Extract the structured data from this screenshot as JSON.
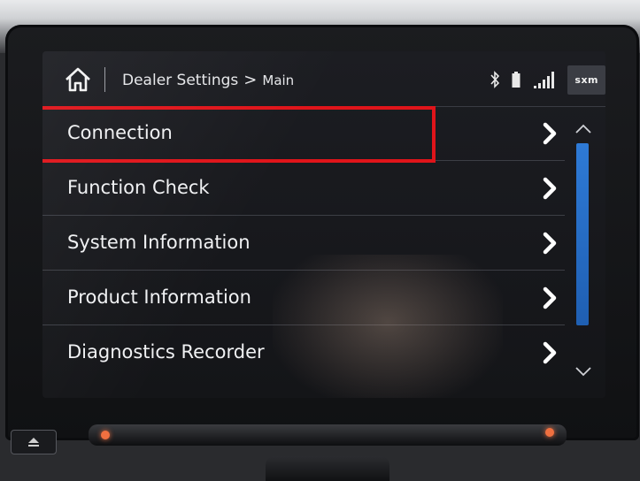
{
  "header": {
    "breadcrumb_root": "Dealer Settings",
    "breadcrumb_separator": ">",
    "breadcrumb_leaf": "Main",
    "status_icons": [
      "bluetooth-icon",
      "battery-icon",
      "signal-icon"
    ],
    "sxm_label": "sxm"
  },
  "menu": {
    "items": [
      {
        "label": "Connection",
        "highlighted": true
      },
      {
        "label": "Function Check"
      },
      {
        "label": "System Information"
      },
      {
        "label": "Product Information"
      },
      {
        "label": "Diagnostics Recorder"
      }
    ]
  },
  "colors": {
    "highlight": "#e0141a",
    "scrollbar": "#2e7ad6"
  }
}
